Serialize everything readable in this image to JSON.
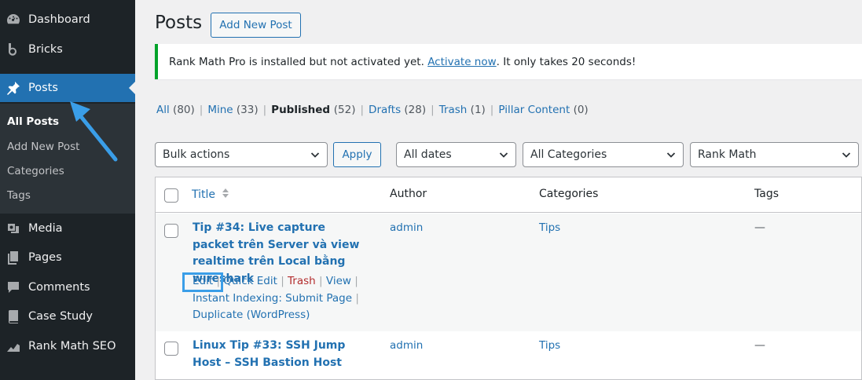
{
  "sidebar": {
    "items": [
      {
        "label": "Dashboard",
        "icon": "dashboard-icon"
      },
      {
        "label": "Bricks",
        "icon": "bricks-logo-icon"
      },
      {
        "label": "Posts",
        "icon": "pin-icon"
      },
      {
        "label": "Media",
        "icon": "media-icon"
      },
      {
        "label": "Pages",
        "icon": "pages-icon"
      },
      {
        "label": "Comments",
        "icon": "comments-icon"
      },
      {
        "label": "Case Study",
        "icon": "book-icon"
      },
      {
        "label": "Rank Math SEO",
        "icon": "rank-math-icon"
      }
    ],
    "submenu": [
      "All Posts",
      "Add New Post",
      "Categories",
      "Tags"
    ]
  },
  "header": {
    "title": "Posts",
    "add_new": "Add New Post"
  },
  "notice": {
    "before": "Rank Math Pro is installed but not activated yet. ",
    "link": "Activate now",
    "after": ". It only takes 20 seconds!"
  },
  "views": [
    {
      "label": "All",
      "count": "(80)"
    },
    {
      "label": "Mine",
      "count": "(33)"
    },
    {
      "label": "Published",
      "count": "(52)"
    },
    {
      "label": "Drafts",
      "count": "(28)"
    },
    {
      "label": "Trash",
      "count": "(1)"
    },
    {
      "label": "Pillar Content",
      "count": "(0)"
    }
  ],
  "filters": {
    "bulk": "Bulk actions",
    "apply": "Apply",
    "dates": "All dates",
    "categories": "All Categories",
    "rankmath": "Rank Math"
  },
  "table": {
    "columns": [
      "Title",
      "Author",
      "Categories",
      "Tags"
    ],
    "rows": [
      {
        "title": "Tip #34: Live capture packet trên Server và view realtime trên Local bằng wireshark",
        "author": "admin",
        "category": "Tips",
        "tags": "—"
      },
      {
        "title": "Linux Tip #33: SSH Jump Host – SSH Bastion Host",
        "author": "admin",
        "category": "Tips",
        "tags": "—"
      }
    ],
    "row_actions": {
      "edit": "Edit",
      "quick_edit": "Quick Edit",
      "trash": "Trash",
      "view": "View",
      "instant_indexing": "Instant Indexing: Submit Page",
      "duplicate": "Duplicate (WordPress)"
    }
  },
  "colors": {
    "sidebar_bg": "#1d2327",
    "accent": "#2271b1",
    "notice_border": "#00a32a",
    "trash": "#b32d2e",
    "highlight": "#3a9ee8"
  }
}
